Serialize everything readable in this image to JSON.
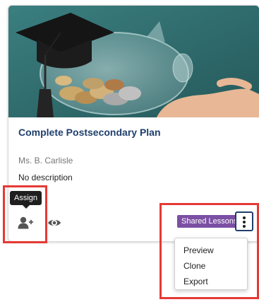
{
  "card": {
    "title": "Complete Postsecondary Plan",
    "author": "Ms. B. Carlisle",
    "description": "No description",
    "image_alt": "Graduation cap on piggy bank with coins"
  },
  "actions": {
    "assign_tooltip": "Assign",
    "assign_icon": "user-plus-icon",
    "preview_icon": "eye-icon"
  },
  "badge": {
    "label": "Shared Lessons",
    "color": "#7b4fa3"
  },
  "menu": {
    "items": [
      {
        "label": "Preview"
      },
      {
        "label": "Clone"
      },
      {
        "label": "Export"
      }
    ]
  },
  "colors": {
    "title": "#1f3f6d",
    "highlight": "#e53935",
    "hero_background": "#2f6e70"
  }
}
